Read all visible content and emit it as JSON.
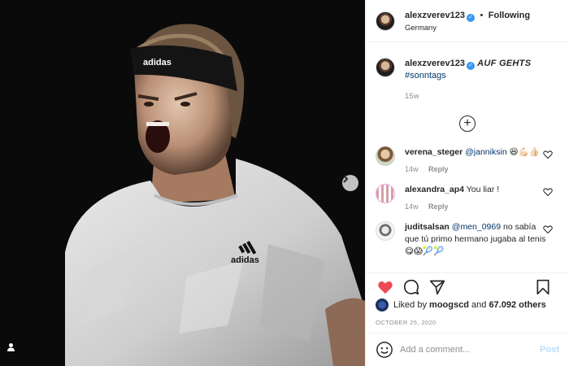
{
  "post": {
    "image_alt": "Tennis player in white adidas shirt and black adidas headband shouting",
    "shirt_logo": "adidas",
    "headband_logo": "adidas"
  },
  "header": {
    "username": "alexzverev123",
    "separator": "•",
    "follow_status": "Following",
    "location": "Germany"
  },
  "caption": {
    "username": "alexzverev123",
    "text": "AUF GEHTS",
    "hashtag": "#sonntags",
    "age": "15w"
  },
  "comments": [
    {
      "username": "verena_steger",
      "mention": "@janniksin",
      "text": " 😆💪🏻👍🏻",
      "age": "14w",
      "reply": "Reply"
    },
    {
      "username": "alexandra_ap4",
      "mention": "",
      "text": " You liar !",
      "age": "14w",
      "reply": "Reply"
    },
    {
      "username": "juditsalsan",
      "mention": "@men_0969",
      "text": " no sabía que tú primo hermano jugaba al tenis 😋😱🎾🎾"
    }
  ],
  "likes": {
    "prefix": "Liked by",
    "user": "moogscd",
    "joiner": "and",
    "count": "67.092 others"
  },
  "date": "OCTOBER 25, 2020",
  "add_comment": {
    "placeholder": "Add a comment...",
    "post_label": "Post"
  },
  "icons": {
    "like": "heart-filled-icon",
    "comment": "speech-bubble-icon",
    "share": "paper-plane-icon",
    "save": "bookmark-icon",
    "emoji": "smiley-icon",
    "tag": "user-tag-icon",
    "next": "chevron-right-icon",
    "load_more": "plus-circle-icon"
  },
  "colors": {
    "like_red": "#ed4956",
    "link_blue": "#00376b",
    "verified_blue": "#3897f0",
    "muted_gray": "#8e8e8e",
    "post_disabled": "#b2dffc"
  }
}
